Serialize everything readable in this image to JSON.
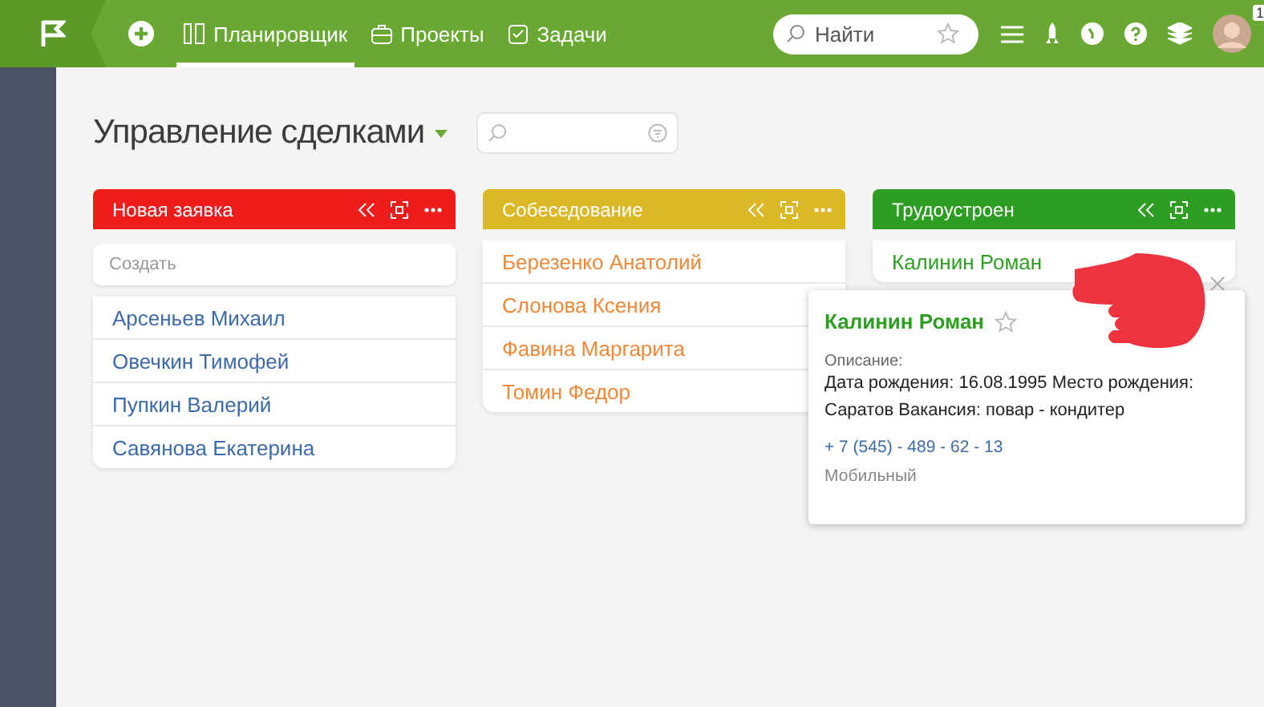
{
  "topbar": {
    "nav": [
      {
        "label": "Планировщик",
        "selected": true
      },
      {
        "label": "Проекты",
        "selected": false
      },
      {
        "label": "Задачи",
        "selected": false
      }
    ],
    "search": {
      "placeholder": "Найти"
    },
    "badge": "1"
  },
  "page": {
    "title": "Управление сделками"
  },
  "columns": [
    {
      "title": "Новая заявка",
      "color": "#f01c1c",
      "create": "Создать",
      "cards": [
        "Арсеньев Михаил",
        "Овечкин Тимофей",
        "Пупкин Валерий",
        "Савянова Екатерина"
      ]
    },
    {
      "title": "Собеседование",
      "color": "#dbb825",
      "cards": [
        "Березенко Анатолий",
        "Слонова Ксения",
        "Фавина Маргарита",
        "Томин Федор"
      ]
    },
    {
      "title": "Трудоустроен",
      "color": "#2e9e22",
      "cards": [
        "Калинин Роман"
      ]
    }
  ],
  "popover": {
    "name": "Калинин Роман",
    "label": "Описание:",
    "text": "Дата рождения: 16.08.1995 Место рождения: Саратов Вакансия: повар - кондитер",
    "phone": "+ 7 (545) - 489 - 62 - 13",
    "phone_type": "Мобильный"
  }
}
